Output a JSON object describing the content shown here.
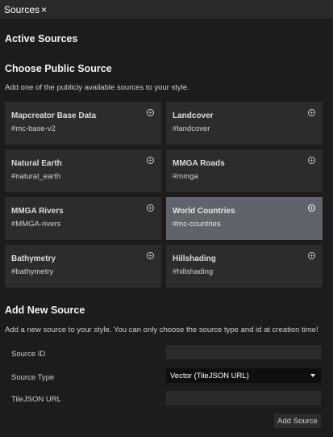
{
  "tab": {
    "title": "Sources",
    "close_glyph": "×",
    "close_icon": "close-icon"
  },
  "active_sources": {
    "heading": "Active Sources"
  },
  "public_sources": {
    "heading": "Choose Public Source",
    "description": "Add one of the publicly available sources to your style.",
    "add_icon": "plus-circle-icon",
    "add_glyph": "+",
    "items": [
      {
        "title": "Mapcreator Base Data",
        "id": "#mc-base-v2",
        "selected": false
      },
      {
        "title": "Landcover",
        "id": "#landcover",
        "selected": false
      },
      {
        "title": "Natural Earth",
        "id": "#natural_earth",
        "selected": false
      },
      {
        "title": "MMGA Roads",
        "id": "#mmga",
        "selected": false
      },
      {
        "title": "MMGA Rivers",
        "id": "#MMGA-rivers",
        "selected": false
      },
      {
        "title": "World Countries",
        "id": "#mc-countries",
        "selected": true
      },
      {
        "title": "Bathymetry",
        "id": "#bathymetry",
        "selected": false
      },
      {
        "title": "Hillshading",
        "id": "#hillshading",
        "selected": false
      }
    ]
  },
  "new_source": {
    "heading": "Add New Source",
    "description": "Add a new source to your style. You can only choose the source type and id at creation time!",
    "source_id": {
      "label": "Source ID",
      "value": ""
    },
    "source_type": {
      "label": "Source Type",
      "value": "Vector (TileJSON URL)",
      "icon": "caret-down-icon"
    },
    "tilejson_url": {
      "label": "TileJSON URL",
      "value": ""
    },
    "add_button": "Add Source"
  },
  "colors": {
    "background": "#1c1c1c",
    "card": "#2c2c2c",
    "card_selected": "#60636a",
    "select_bg": "#0e0e0e"
  }
}
